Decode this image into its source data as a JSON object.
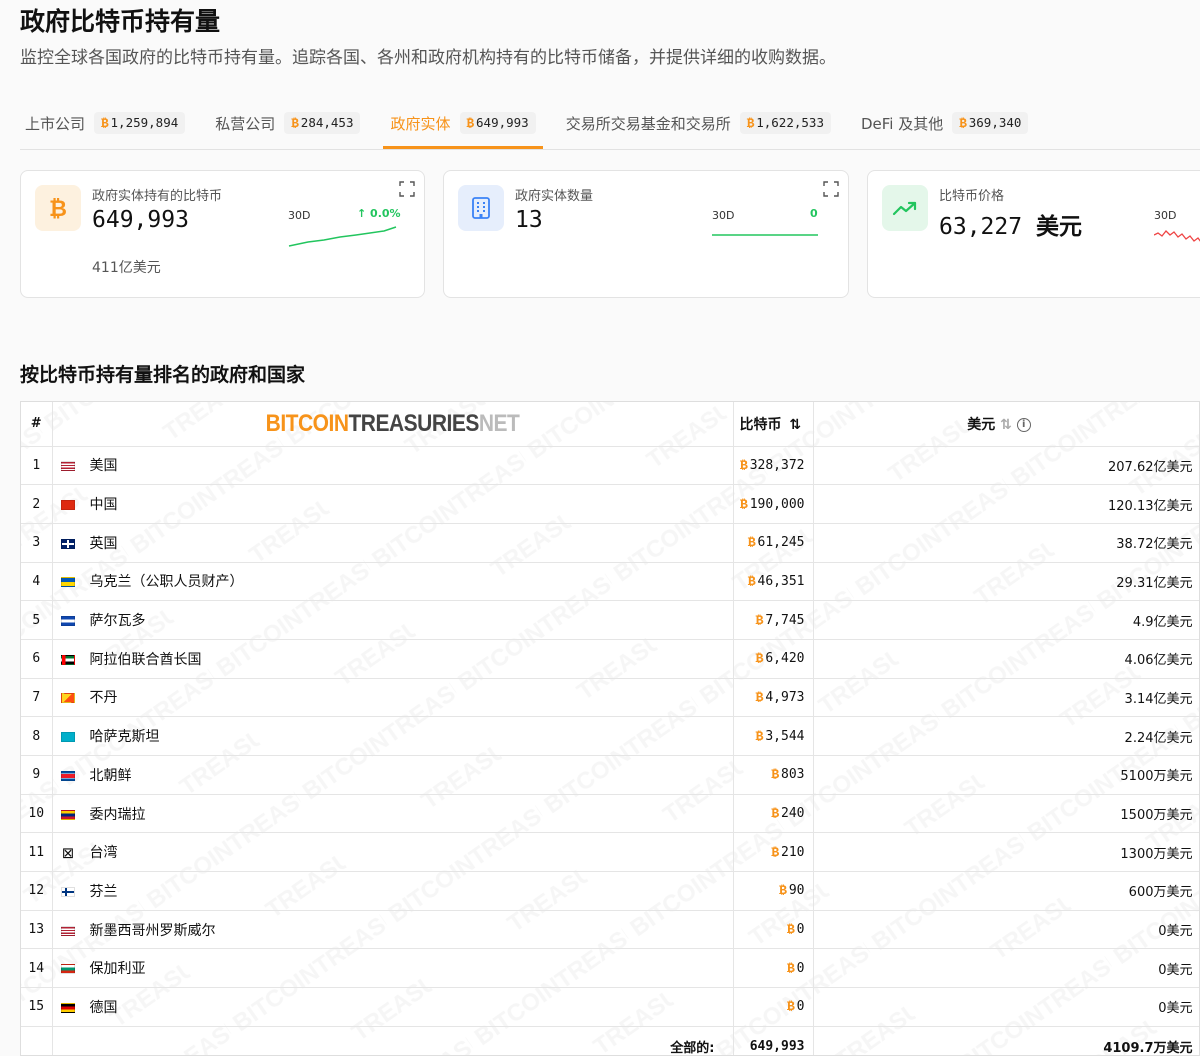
{
  "page": {
    "title": "政府比特币持有量",
    "subtitle": "监控全球各国政府的比特币持有量。追踪各国、各州和政府机构持有的比特币储备，并提供详细的收购数据。"
  },
  "tabs": [
    {
      "label": "上市公司",
      "count": "1,259,894",
      "active": false
    },
    {
      "label": "私营公司",
      "count": "284,453",
      "active": false
    },
    {
      "label": "政府实体",
      "count": "649,993",
      "active": true
    },
    {
      "label": "交易所交易基金和交易所",
      "count": "1,622,533",
      "active": false
    },
    {
      "label": "DeFi 及其他",
      "count": "369,340",
      "active": false
    }
  ],
  "btc_symbol": "₿",
  "cards": {
    "holdings": {
      "label": "政府实体持有的比特币",
      "value": "649,993",
      "sub": "411亿美元",
      "period": "30D",
      "change": "↑ 0.0%",
      "icon": "bitcoin-icon"
    },
    "entities": {
      "label": "政府实体数量",
      "value": "13",
      "period": "30D",
      "change": "0",
      "icon": "building-icon"
    },
    "price": {
      "label": "比特币价格",
      "value": "63,227",
      "unit": "美元",
      "period": "30D",
      "icon": "trending-up-icon"
    }
  },
  "colors": {
    "accent": "#f7931a",
    "positive": "#22c55e",
    "negative": "#ef4444"
  },
  "section_title": "按比特币持有量排名的政府和国家",
  "table": {
    "headers": {
      "rank": "#",
      "btc": "比特币",
      "usd": "美元"
    },
    "brand": {
      "part1": "BITCOIN",
      "part2": "TREASURIES",
      "part3": "NET"
    },
    "rows": [
      {
        "rank": "1",
        "name": "美国",
        "flag": "us",
        "btc": "328,372",
        "usd": "207.62亿美元"
      },
      {
        "rank": "2",
        "name": "中国",
        "flag": "cn",
        "btc": "190,000",
        "usd": "120.13亿美元"
      },
      {
        "rank": "3",
        "name": "英国",
        "flag": "gb",
        "btc": "61,245",
        "usd": "38.72亿美元"
      },
      {
        "rank": "4",
        "name": "乌克兰（公职人员财产）",
        "flag": "ua",
        "btc": "46,351",
        "usd": "29.31亿美元"
      },
      {
        "rank": "5",
        "name": "萨尔瓦多",
        "flag": "sv",
        "btc": "7,745",
        "usd": "4.9亿美元"
      },
      {
        "rank": "6",
        "name": "阿拉伯联合酋长国",
        "flag": "ae",
        "btc": "6,420",
        "usd": "4.06亿美元"
      },
      {
        "rank": "7",
        "name": "不丹",
        "flag": "bt",
        "btc": "4,973",
        "usd": "3.14亿美元"
      },
      {
        "rank": "8",
        "name": "哈萨克斯坦",
        "flag": "kz",
        "btc": "3,544",
        "usd": "2.24亿美元"
      },
      {
        "rank": "9",
        "name": "北朝鲜",
        "flag": "kp",
        "btc": "803",
        "usd": "5100万美元"
      },
      {
        "rank": "10",
        "name": "委内瑞拉",
        "flag": "ve",
        "btc": "240",
        "usd": "1500万美元"
      },
      {
        "rank": "11",
        "name": "台湾",
        "flag": "tw",
        "btc": "210",
        "usd": "1300万美元"
      },
      {
        "rank": "12",
        "name": "芬兰",
        "flag": "fi",
        "btc": "90",
        "usd": "600万美元"
      },
      {
        "rank": "13",
        "name": "新墨西哥州罗斯威尔",
        "flag": "us",
        "btc": "0",
        "usd": "0美元"
      },
      {
        "rank": "14",
        "name": "保加利亚",
        "flag": "bg",
        "btc": "0",
        "usd": "0美元"
      },
      {
        "rank": "15",
        "name": "德国",
        "flag": "de",
        "btc": "0",
        "usd": "0美元"
      }
    ],
    "footer": {
      "label": "全部的:",
      "btc": "649,993",
      "usd": "4109.7万美元"
    }
  }
}
